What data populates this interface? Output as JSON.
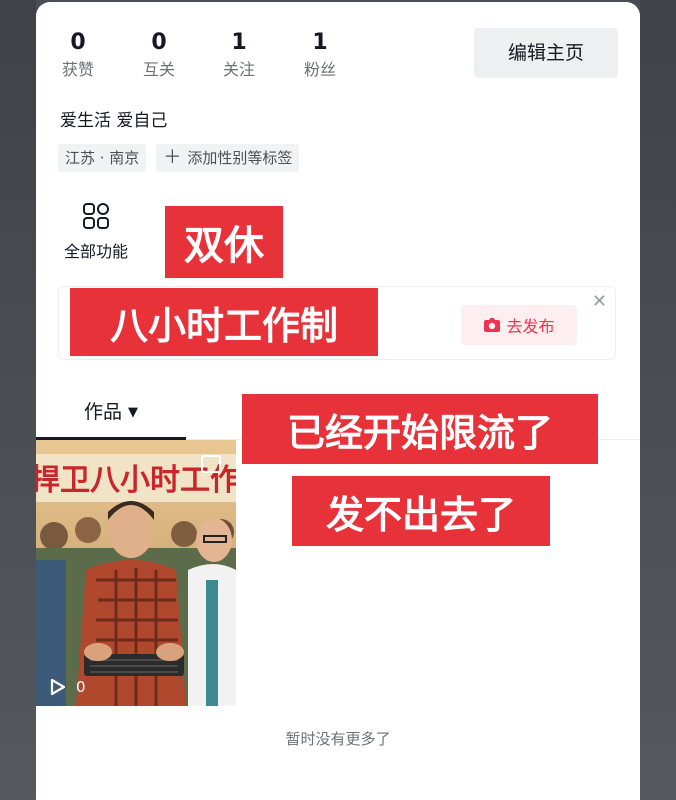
{
  "stats": [
    {
      "value": "0",
      "label": "获赞"
    },
    {
      "value": "0",
      "label": "互关"
    },
    {
      "value": "1",
      "label": "关注"
    },
    {
      "value": "1",
      "label": "粉丝"
    }
  ],
  "edit_button": "编辑主页",
  "bio": "爱生活 爱自己",
  "tags": {
    "location": "江苏 · 南京",
    "add_tag_icon": "plus-icon",
    "add_tag": "添加性别等标签"
  },
  "functions": {
    "icon": "grid-icon",
    "label": "全部功能"
  },
  "promo": {
    "publish_icon": "camera-icon",
    "publish_label": "去发布",
    "close_icon": "close-icon"
  },
  "tabs": {
    "works_label": "作品",
    "dropdown_icon": "triangle-down-icon"
  },
  "video": {
    "banner_text": "捍卫八小时工作制",
    "play_icon": "play-icon",
    "play_count": "0"
  },
  "footer": "暂时没有更多了",
  "overlays": {
    "line1": "双休",
    "line2": "八小时工作制",
    "line3": "已经开始限流了",
    "line4": "发不出去了"
  },
  "colors": {
    "accent": "#f03250",
    "overlay_red": "#e8323a",
    "text": "#161823",
    "muted": "#6e7076"
  }
}
